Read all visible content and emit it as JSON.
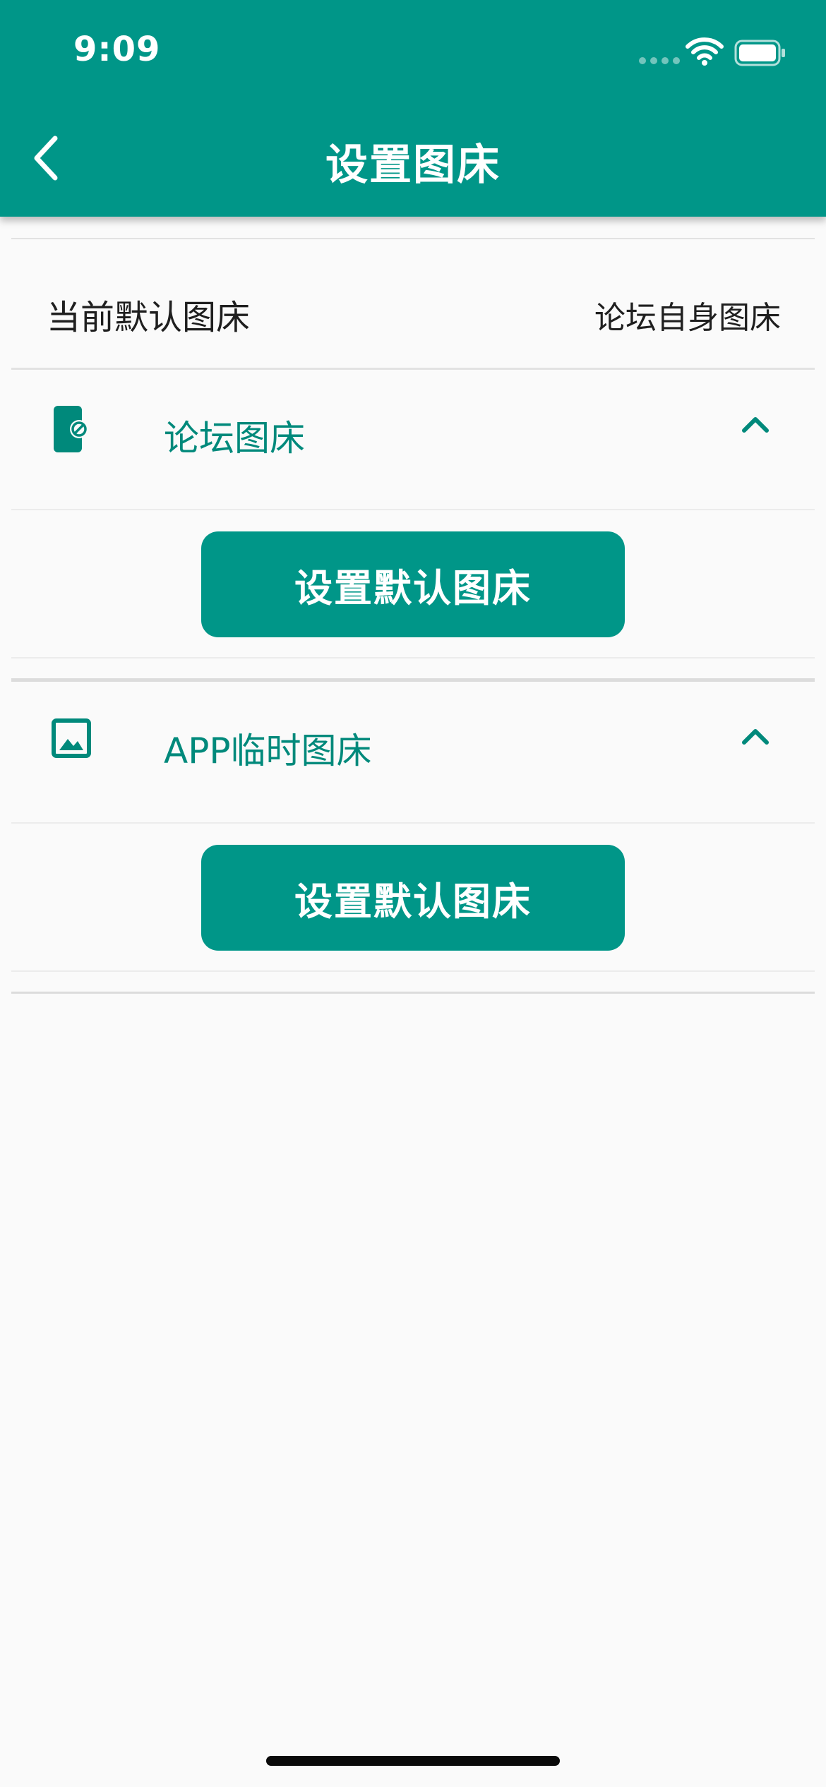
{
  "status_bar": {
    "time": "9:09"
  },
  "header": {
    "title": "设置图床"
  },
  "current_default": {
    "label": "当前默认图床",
    "value": "论坛自身图床"
  },
  "sections": [
    {
      "title": "论坛图床",
      "icon": "phone-forbidden-icon",
      "expanded": true,
      "button_label": "设置默认图床"
    },
    {
      "title": "APP临时图床",
      "icon": "image-icon",
      "expanded": true,
      "button_label": "设置默认图床"
    }
  ],
  "colors": {
    "primary": "#009688",
    "accent_text": "#00897b",
    "background": "#fafafa"
  }
}
